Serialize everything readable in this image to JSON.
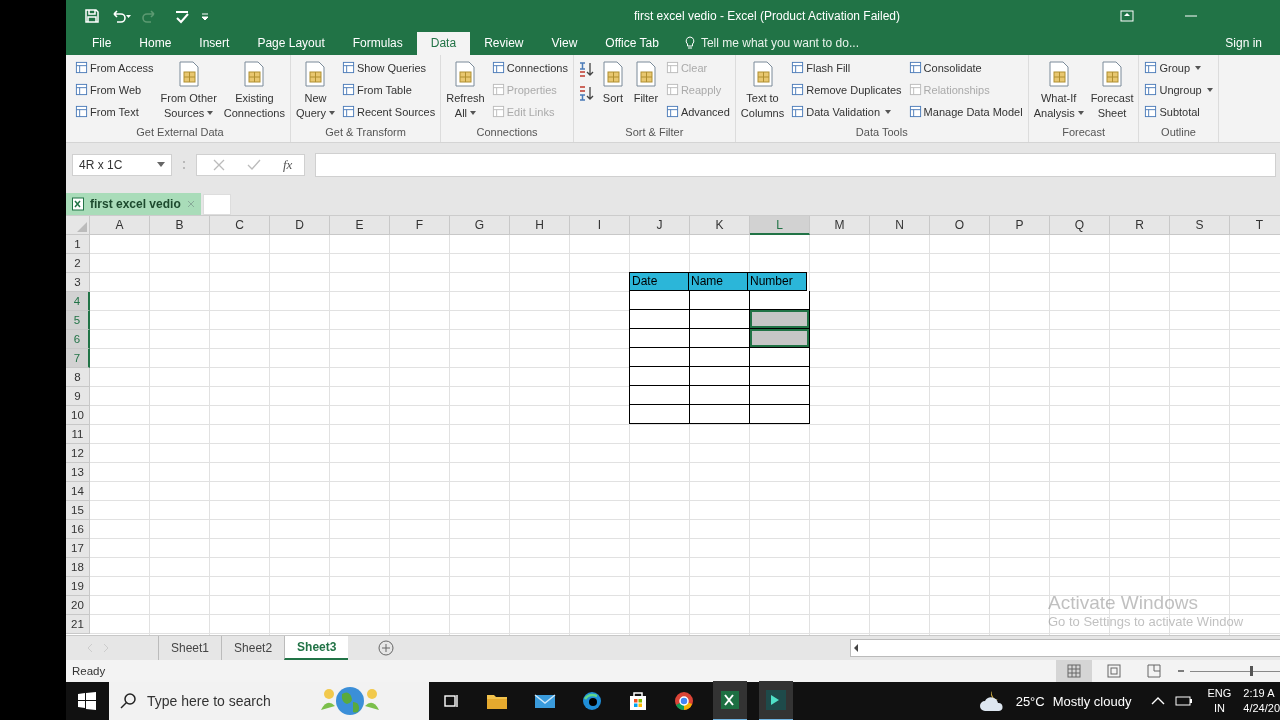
{
  "window": {
    "title": "first excel vedio - Excel (Product Activation Failed)"
  },
  "tabs": [
    {
      "label": "File",
      "selected": false
    },
    {
      "label": "Home",
      "selected": false
    },
    {
      "label": "Insert",
      "selected": false
    },
    {
      "label": "Page Layout",
      "selected": false
    },
    {
      "label": "Formulas",
      "selected": false
    },
    {
      "label": "Data",
      "selected": true
    },
    {
      "label": "Review",
      "selected": false
    },
    {
      "label": "View",
      "selected": false
    },
    {
      "label": "Office Tab",
      "selected": false
    }
  ],
  "tell_me": {
    "placeholder": "Tell me what you want to do..."
  },
  "sign_in": "Sign in",
  "ribbon": [
    {
      "label": "Get External Data",
      "columns": [
        {
          "kind": "small",
          "items": [
            {
              "label": "From Access",
              "disabled": false
            },
            {
              "label": "From Web",
              "disabled": false
            },
            {
              "label": "From Text",
              "disabled": false
            }
          ]
        },
        {
          "kind": "large",
          "lines": [
            "From Other",
            "Sources"
          ],
          "dropdown": true
        },
        {
          "kind": "large",
          "lines": [
            "Existing",
            "Connections"
          ],
          "dropdown": false
        }
      ]
    },
    {
      "label": "Get & Transform",
      "columns": [
        {
          "kind": "large",
          "lines": [
            "New",
            "Query"
          ],
          "dropdown": true
        },
        {
          "kind": "small",
          "items": [
            {
              "label": "Show Queries",
              "disabled": false
            },
            {
              "label": "From Table",
              "disabled": false
            },
            {
              "label": "Recent Sources",
              "disabled": false
            }
          ]
        }
      ]
    },
    {
      "label": "Connections",
      "columns": [
        {
          "kind": "large",
          "lines": [
            "Refresh",
            "All"
          ],
          "dropdown": true
        },
        {
          "kind": "small",
          "items": [
            {
              "label": "Connections",
              "disabled": false
            },
            {
              "label": "Properties",
              "disabled": true
            },
            {
              "label": "Edit Links",
              "disabled": true
            }
          ]
        }
      ]
    },
    {
      "label": "Sort & Filter",
      "columns": [
        {
          "kind": "sort"
        },
        {
          "kind": "large",
          "lines": [
            "Sort"
          ],
          "dropdown": false
        },
        {
          "kind": "large",
          "lines": [
            "Filter"
          ],
          "dropdown": false
        },
        {
          "kind": "small",
          "items": [
            {
              "label": "Clear",
              "disabled": true
            },
            {
              "label": "Reapply",
              "disabled": true
            },
            {
              "label": "Advanced",
              "disabled": false
            }
          ]
        }
      ]
    },
    {
      "label": "Data Tools",
      "columns": [
        {
          "kind": "large",
          "lines": [
            "Text to",
            "Columns"
          ],
          "dropdown": false
        },
        {
          "kind": "small",
          "items": [
            {
              "label": "Flash Fill",
              "disabled": false
            },
            {
              "label": "Remove Duplicates",
              "disabled": false
            },
            {
              "label": "Data Validation",
              "disabled": false,
              "dropdown": true
            }
          ]
        },
        {
          "kind": "small",
          "items": [
            {
              "label": "Consolidate",
              "disabled": false
            },
            {
              "label": "Relationships",
              "disabled": true
            },
            {
              "label": "Manage Data Model",
              "disabled": false
            }
          ]
        }
      ]
    },
    {
      "label": "Forecast",
      "columns": [
        {
          "kind": "large",
          "lines": [
            "What-If",
            "Analysis"
          ],
          "dropdown": true
        },
        {
          "kind": "large",
          "lines": [
            "Forecast",
            "Sheet"
          ],
          "dropdown": false
        }
      ]
    },
    {
      "label": "Outline",
      "columns": [
        {
          "kind": "small",
          "items": [
            {
              "label": "Group",
              "disabled": false,
              "dropdown": true
            },
            {
              "label": "Ungroup",
              "disabled": false,
              "dropdown": true
            },
            {
              "label": "Subtotal",
              "disabled": false
            }
          ]
        }
      ]
    }
  ],
  "name_box": "4R x 1C",
  "function_label": "fx",
  "document_tab": "first excel vedio",
  "grid": {
    "columns": [
      {
        "label": "A",
        "selected": false
      },
      {
        "label": "B",
        "selected": false
      },
      {
        "label": "C",
        "selected": false
      },
      {
        "label": "D",
        "selected": false
      },
      {
        "label": "E",
        "selected": false
      },
      {
        "label": "F",
        "selected": false
      },
      {
        "label": "G",
        "selected": false
      },
      {
        "label": "H",
        "selected": false
      },
      {
        "label": "I",
        "selected": false
      },
      {
        "label": "J",
        "selected": false
      },
      {
        "label": "K",
        "selected": false
      },
      {
        "label": "L",
        "selected": true
      },
      {
        "label": "M",
        "selected": false
      },
      {
        "label": "N",
        "selected": false
      },
      {
        "label": "O",
        "selected": false
      },
      {
        "label": "P",
        "selected": false
      },
      {
        "label": "Q",
        "selected": false
      },
      {
        "label": "R",
        "selected": false
      },
      {
        "label": "S",
        "selected": false
      },
      {
        "label": "T",
        "selected": false
      }
    ],
    "rows": [
      {
        "label": "1",
        "selected": false
      },
      {
        "label": "2",
        "selected": false
      },
      {
        "label": "3",
        "selected": false
      },
      {
        "label": "4",
        "selected": true
      },
      {
        "label": "5",
        "selected": true
      },
      {
        "label": "6",
        "selected": true
      },
      {
        "label": "7",
        "selected": true
      },
      {
        "label": "8",
        "selected": false
      },
      {
        "label": "9",
        "selected": false
      },
      {
        "label": "10",
        "selected": false
      },
      {
        "label": "11",
        "selected": false
      },
      {
        "label": "12",
        "selected": false
      },
      {
        "label": "13",
        "selected": false
      },
      {
        "label": "14",
        "selected": false
      },
      {
        "label": "15",
        "selected": false
      },
      {
        "label": "16",
        "selected": false
      },
      {
        "label": "17",
        "selected": false
      },
      {
        "label": "18",
        "selected": false
      },
      {
        "label": "19",
        "selected": false
      },
      {
        "label": "20",
        "selected": false
      },
      {
        "label": "21",
        "selected": false
      }
    ]
  },
  "table": {
    "headers": [
      "Date",
      "Name",
      "Number"
    ],
    "rows": [
      {
        "cells": [
          {
            "selected": false
          },
          {
            "selected": false
          },
          {
            "selected": false
          }
        ]
      },
      {
        "cells": [
          {
            "selected": false
          },
          {
            "selected": false
          },
          {
            "selected": true
          }
        ]
      },
      {
        "cells": [
          {
            "selected": false
          },
          {
            "selected": false
          },
          {
            "selected": true
          }
        ]
      },
      {
        "cells": [
          {
            "selected": false
          },
          {
            "selected": false
          },
          {
            "selected": false
          }
        ]
      },
      {
        "cells": [
          {
            "selected": false
          },
          {
            "selected": false
          },
          {
            "selected": false
          }
        ]
      },
      {
        "cells": [
          {
            "selected": false
          },
          {
            "selected": false
          },
          {
            "selected": false
          }
        ]
      },
      {
        "cells": [
          {
            "selected": false
          },
          {
            "selected": false
          },
          {
            "selected": false
          }
        ]
      }
    ]
  },
  "sheet_tabs": [
    {
      "label": "Sheet1",
      "selected": false
    },
    {
      "label": "Sheet2",
      "selected": false
    },
    {
      "label": "Sheet3",
      "selected": true
    }
  ],
  "status_bar": {
    "text": "Ready",
    "zoom": {
      "level": 0.6
    }
  },
  "activation_notice": {
    "title": "Activate Windows",
    "subtitle": "Go to Settings to activate Window"
  },
  "taskbar": {
    "search": {
      "placeholder": "Type here to search"
    },
    "temperature": "25°C",
    "weather": "Mostly cloudy",
    "language": [
      "ENG",
      "IN"
    ],
    "time": "2:19 A",
    "date": "4/24/20"
  }
}
